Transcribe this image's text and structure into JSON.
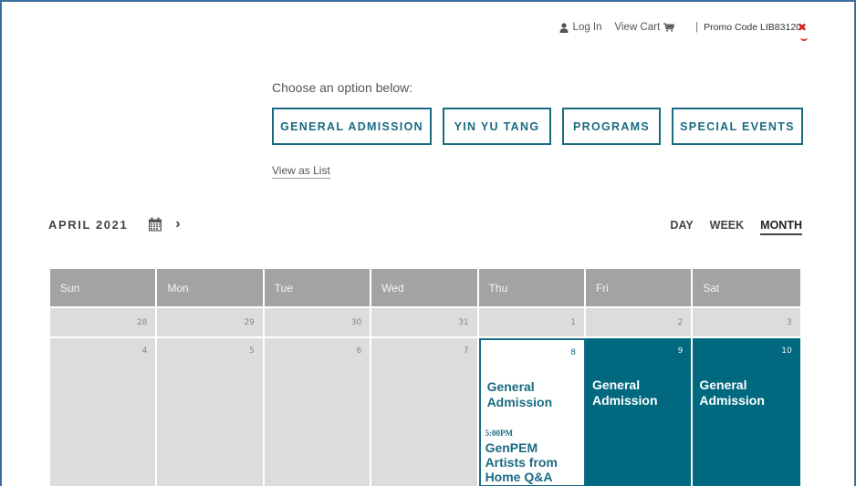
{
  "topbar": {
    "login_label": "Log In",
    "cart_label": "View Cart",
    "separator": "|",
    "promo_label": "Promo Code LIB83120",
    "promo_remove": "✖"
  },
  "choose_label": "Choose an option below:",
  "options": [
    "GENERAL ADMISSION",
    "YIN YU TANG",
    "PROGRAMS",
    "SPECIAL EVENTS"
  ],
  "view_as_list": "View as List",
  "month_label": "APRIL 2021",
  "next_label": "›",
  "views": [
    "DAY",
    "WEEK",
    "MONTH"
  ],
  "active_view": "MONTH",
  "weekdays": [
    "Sun",
    "Mon",
    "Tue",
    "Wed",
    "Thu",
    "Fri",
    "Sat"
  ],
  "week1": [
    "28",
    "29",
    "30",
    "31",
    "1",
    "2",
    "3"
  ],
  "week2": [
    {
      "day": "4"
    },
    {
      "day": "5"
    },
    {
      "day": "6"
    },
    {
      "day": "7"
    },
    {
      "day": "8",
      "event": "General Admission",
      "time": "5:00PM",
      "event2": "GenPEM Artists from Home Q&A"
    },
    {
      "day": "9",
      "event": "General Admission"
    },
    {
      "day": "10",
      "event": "General Admission"
    }
  ],
  "colors": {
    "accent": "#1a6b82",
    "teal_fill": "#00687f",
    "header_gray": "#a3a3a3",
    "cell_gray": "#dcdcdc",
    "promo_red": "#d9261c"
  }
}
